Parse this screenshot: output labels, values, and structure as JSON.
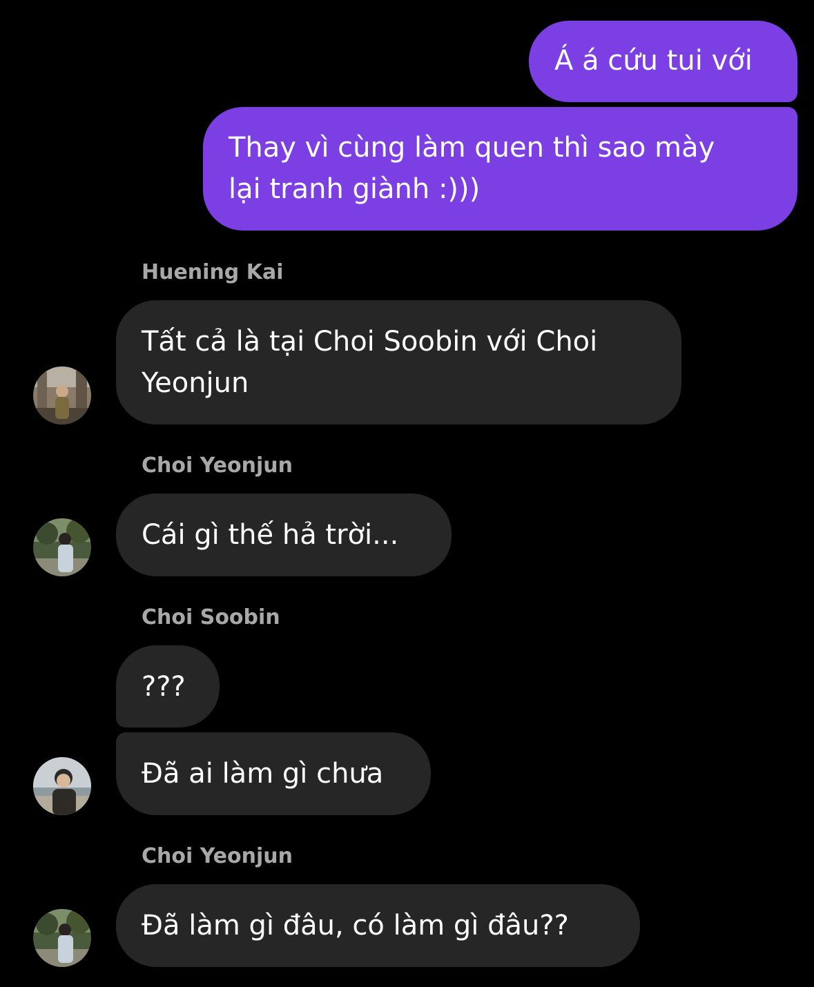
{
  "colors": {
    "background": "#000000",
    "outgoing_bubble": "#7b3fe4",
    "incoming_bubble": "#262626",
    "sender_name": "#a8a8a8",
    "message_text": "#ffffff"
  },
  "messages": {
    "out1": {
      "text": "Á á cứu tui với"
    },
    "out2": {
      "line1": "Thay vì cùng làm quen thì sao mày",
      "line2": "lại tranh giành :)))"
    },
    "hk_sender": "Huening Kai",
    "hk1": {
      "line1": "Tất cả là tại Choi Soobin với Choi",
      "line2": "Yeonjun"
    },
    "cy_sender_1": "Choi Yeonjun",
    "cy1": {
      "text": "Cái gì thế hả trời..."
    },
    "cs_sender": "Choi Soobin",
    "cs1": {
      "text": "???"
    },
    "cs2": {
      "text": "Đã ai làm gì chưa"
    },
    "cy_sender_2": "Choi Yeonjun",
    "cy2": {
      "text": "Đã làm gì đâu, có làm gì đâu??"
    }
  },
  "avatars": {
    "huening_kai": "avatar-huening-kai",
    "choi_yeonjun": "avatar-choi-yeonjun",
    "choi_soobin": "avatar-choi-soobin"
  }
}
